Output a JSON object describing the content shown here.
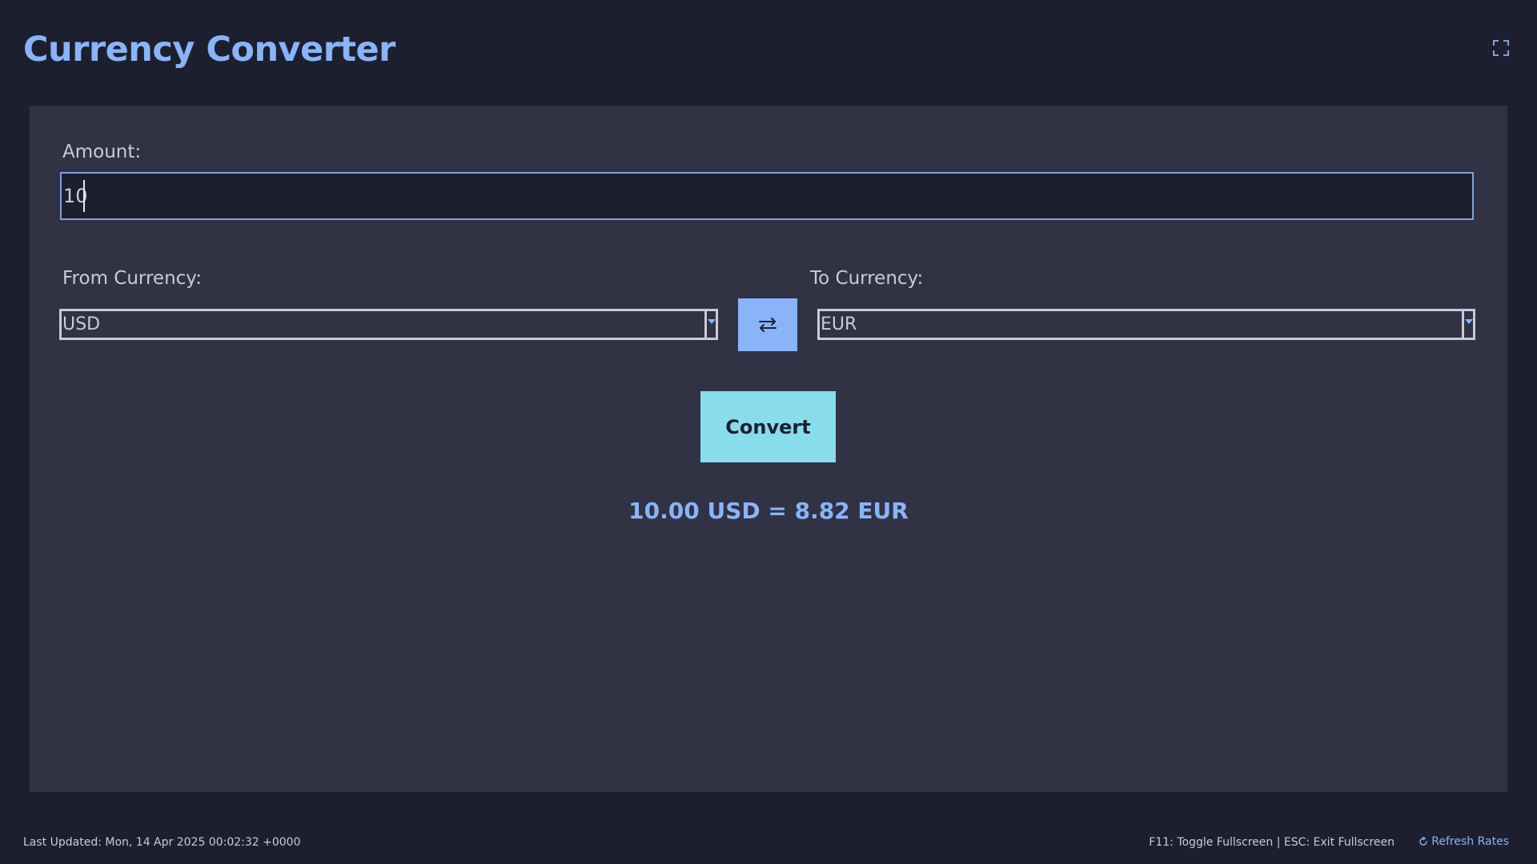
{
  "app": {
    "title": "Currency Converter"
  },
  "form": {
    "amount_label": "Amount:",
    "amount_value": "10",
    "from_label": "From Currency:",
    "from_value": "USD",
    "to_label": "To Currency:",
    "to_value": "EUR",
    "swap_icon": "swap-arrows-icon",
    "convert_label": "Convert",
    "result_text": "10.00 USD = 8.82 EUR"
  },
  "footer": {
    "last_updated": "Last Updated: Mon, 14 Apr 2025 00:02:32 +0000",
    "shortcuts": "F11: Toggle Fullscreen | ESC: Exit Fullscreen",
    "refresh_label": "Refresh Rates",
    "refresh_icon": "refresh-icon"
  },
  "icons": {
    "fullscreen": "fullscreen-icon"
  },
  "colors": {
    "background": "#1e1f2e",
    "panel": "#313244",
    "accent": "#89b4fa",
    "convert_button": "#89dceb",
    "text": "#c9cbd6"
  }
}
